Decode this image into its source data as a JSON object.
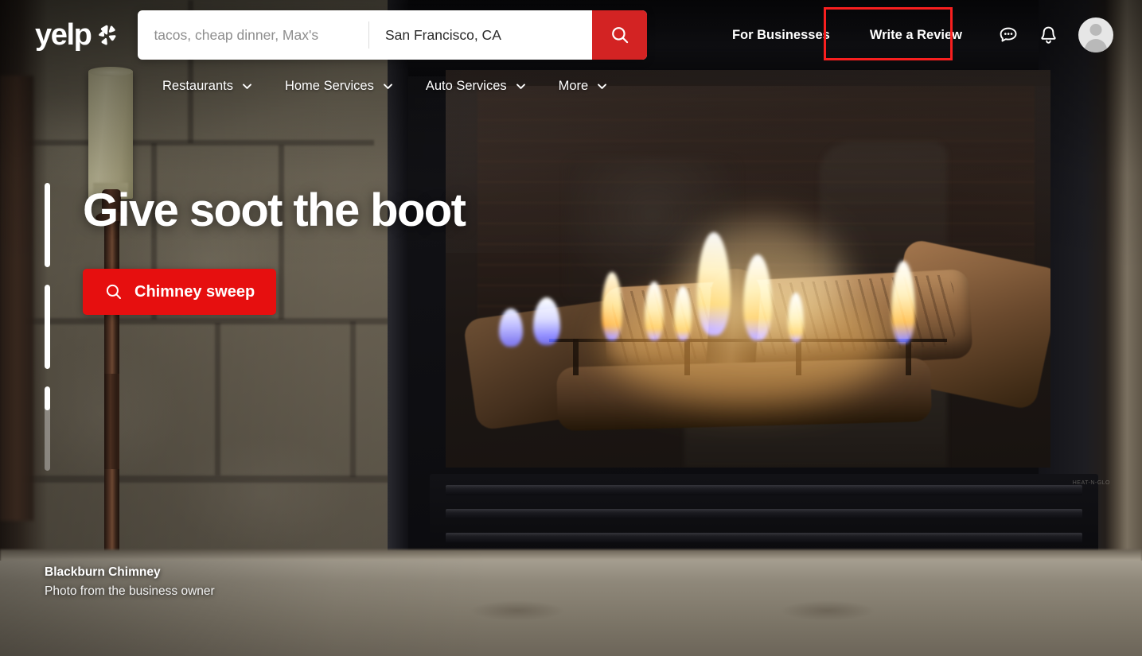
{
  "brand": {
    "name": "yelp",
    "accent_red": "#d32323",
    "cta_red": "#e60f0f",
    "annotation_red": "#f81f1f"
  },
  "search": {
    "find_placeholder": "tacos, cheap dinner, Max's",
    "find_value": "",
    "near_placeholder": "San Francisco, CA",
    "near_value": "San Francisco, CA",
    "submit_icon": "search-icon"
  },
  "header": {
    "links": [
      {
        "label": "For Businesses",
        "name": "for-businesses"
      },
      {
        "label": "Write a Review",
        "name": "write-a-review"
      }
    ],
    "icons": [
      {
        "name": "messages-icon",
        "label": "Messages"
      },
      {
        "name": "notifications-bell-icon",
        "label": "Notifications"
      }
    ],
    "avatar_label": "User account"
  },
  "nav": {
    "items": [
      {
        "label": "Restaurants",
        "icon": "chevron-down-icon"
      },
      {
        "label": "Home Services",
        "icon": "chevron-down-icon"
      },
      {
        "label": "Auto Services",
        "icon": "chevron-down-icon"
      },
      {
        "label": "More",
        "icon": "chevron-down-icon"
      }
    ]
  },
  "hero": {
    "title": "Give soot the boot",
    "cta_label": "Chimney sweep",
    "cta_icon": "search-icon",
    "credit_business": "Blackburn Chimney",
    "credit_caption": "Photo from the business owner",
    "carousel": {
      "slides": 3,
      "active_index": 2,
      "fills_percent": [
        100,
        100,
        28
      ]
    }
  },
  "vent": {
    "brand_label": "HEAT-N-GLO"
  }
}
